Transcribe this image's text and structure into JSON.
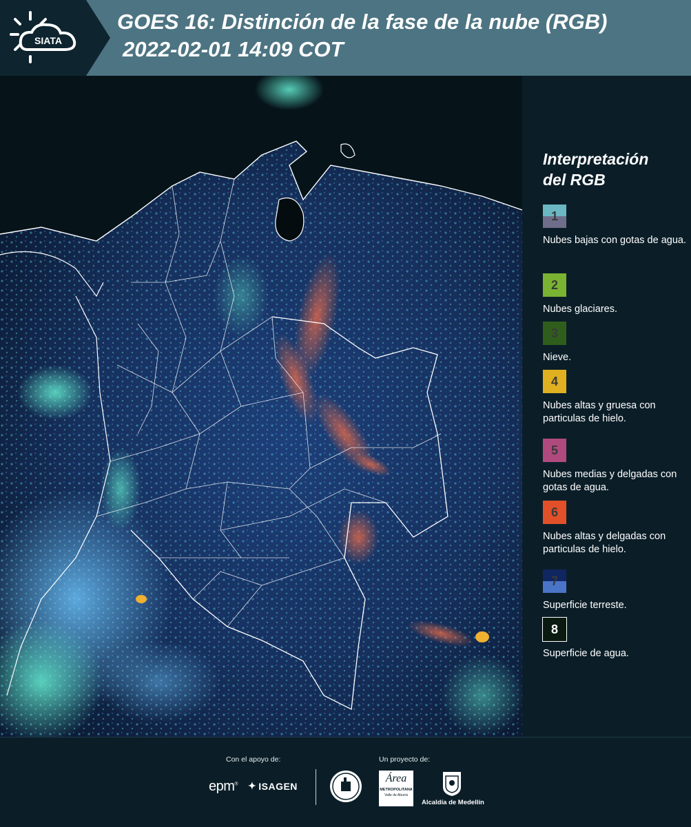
{
  "header": {
    "logo_text": "SIATA",
    "title_line1": "GOES 16: Distinción de la fase de la nube (RGB)",
    "title_line2": "2022-02-01 14:09 COT"
  },
  "legend": {
    "title_line1": "Interpretación",
    "title_line2": "del RGB",
    "items": [
      {
        "number": "1",
        "label": "Nubes bajas con gotas de agua.",
        "color_top": "#6bb8c4",
        "color_bottom": "#6f6e8a"
      },
      {
        "number": "2",
        "label": "Nubes glaciares.",
        "color_top": "#7ab332",
        "color_bottom": "#7ab332"
      },
      {
        "number": "3",
        "label": "Nieve.",
        "color_top": "#2f5e1c",
        "color_bottom": "#2f5e1c"
      },
      {
        "number": "4",
        "label": "Nubes altas y gruesa con particulas de hielo.",
        "color_top": "#e0b020",
        "color_bottom": "#e0b020"
      },
      {
        "number": "5",
        "label": "Nubes medias y delgadas con gotas de agua.",
        "color_top": "#b04a7e",
        "color_bottom": "#b04a7e"
      },
      {
        "number": "6",
        "label": "Nubes altas y delgadas con particulas de hielo.",
        "color_top": "#e2502a",
        "color_bottom": "#e2502a"
      },
      {
        "number": "7",
        "label": "Superficie terreste.",
        "color_top": "#0f2660",
        "color_bottom": "#4a74c8"
      },
      {
        "number": "8",
        "label": "Superficie de agua.",
        "color_top": "#0a1a10",
        "color_bottom": "#0a1a10"
      }
    ]
  },
  "footer": {
    "support_label": "Con el apoyo de:",
    "project_label": "Un proyecto de:",
    "sponsor1": "epm",
    "sponsor2": "ISAGEN",
    "partner1_line1": "Área",
    "partner1_line2": "METROPOLITANA",
    "partner1_line3": "Valle de Aburrá",
    "partner2": "Alcaldía de Medellín"
  },
  "colors": {
    "header_bg": "#4d7482",
    "panel_bg": "#0b1e28",
    "border_lines": "#ffffff"
  }
}
